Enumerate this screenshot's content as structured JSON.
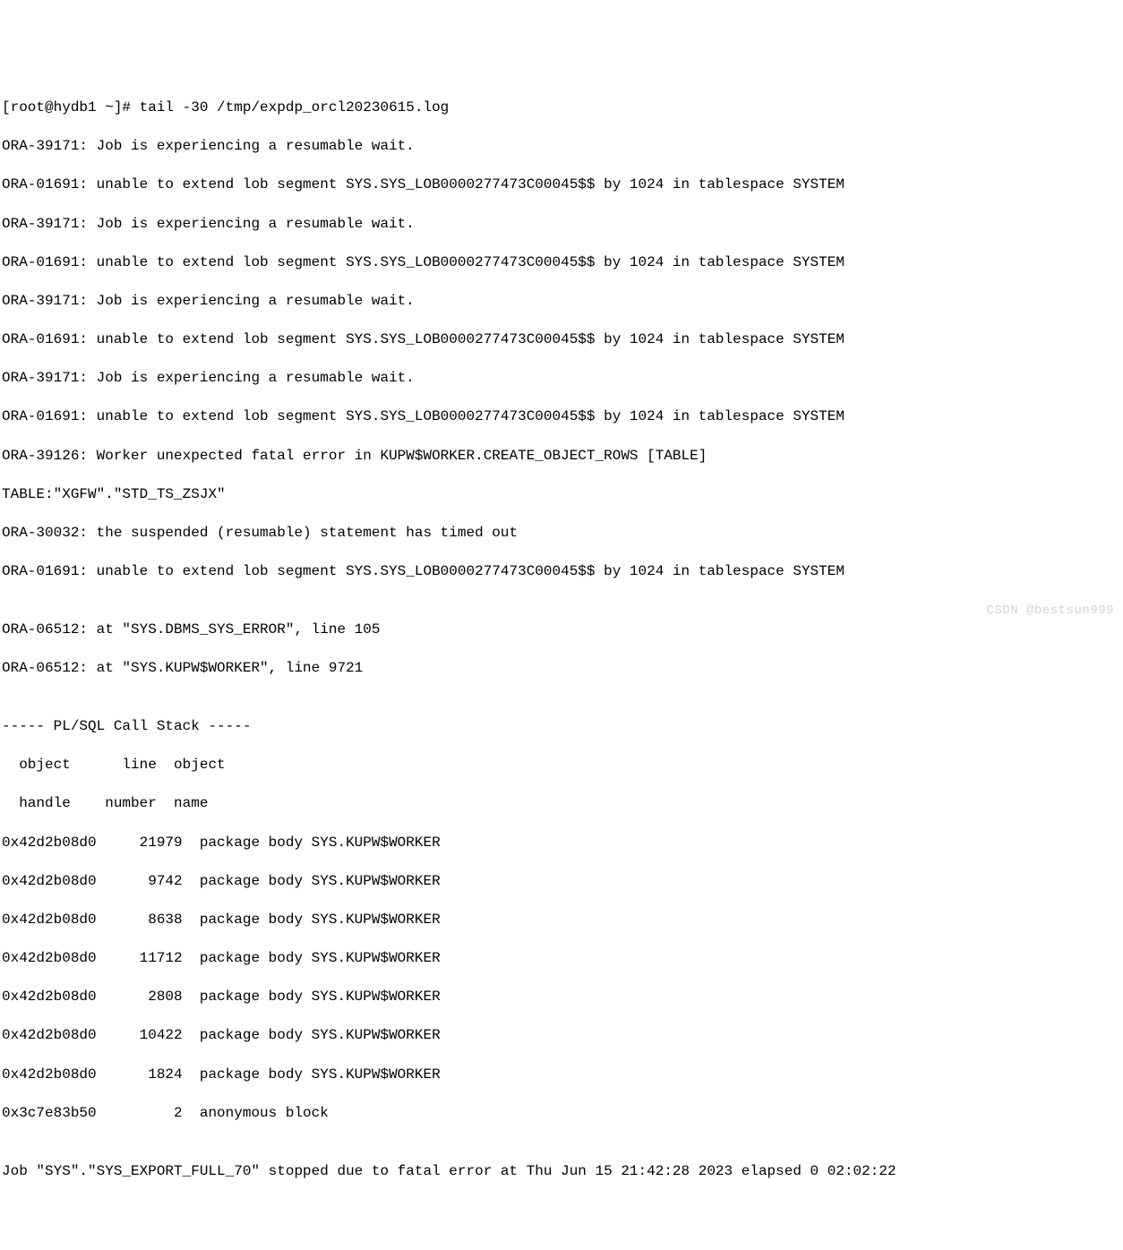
{
  "lines": {
    "l0": "[root@hydb1 ~]# tail -30 /tmp/expdp_orcl20230615.log",
    "l1": "ORA-39171: Job is experiencing a resumable wait.",
    "l2": "ORA-01691: unable to extend lob segment SYS.SYS_LOB0000277473C00045$$ by 1024 in tablespace SYSTEM",
    "l3": "ORA-39171: Job is experiencing a resumable wait.",
    "l4": "ORA-01691: unable to extend lob segment SYS.SYS_LOB0000277473C00045$$ by 1024 in tablespace SYSTEM",
    "l5": "ORA-39171: Job is experiencing a resumable wait.",
    "l6": "ORA-01691: unable to extend lob segment SYS.SYS_LOB0000277473C00045$$ by 1024 in tablespace SYSTEM",
    "l7": "ORA-39171: Job is experiencing a resumable wait.",
    "l8": "ORA-01691: unable to extend lob segment SYS.SYS_LOB0000277473C00045$$ by 1024 in tablespace SYSTEM",
    "l9": "ORA-39126: Worker unexpected fatal error in KUPW$WORKER.CREATE_OBJECT_ROWS [TABLE]",
    "l10": "TABLE:\"XGFW\".\"STD_TS_ZSJX\"",
    "l11": "ORA-30032: the suspended (resumable) statement has timed out",
    "l12": "ORA-01691: unable to extend lob segment SYS.SYS_LOB0000277473C00045$$ by 1024 in tablespace SYSTEM",
    "l13": "",
    "l14": "ORA-06512: at \"SYS.DBMS_SYS_ERROR\", line 105",
    "l15": "ORA-06512: at \"SYS.KUPW$WORKER\", line 9721",
    "l16": "",
    "l17": "----- PL/SQL Call Stack -----",
    "l18": "  object      line  object",
    "l19": "  handle    number  name",
    "l20": "0x42d2b08d0     21979  package body SYS.KUPW$WORKER",
    "l21": "0x42d2b08d0      9742  package body SYS.KUPW$WORKER",
    "l22": "0x42d2b08d0      8638  package body SYS.KUPW$WORKER",
    "l23": "0x42d2b08d0     11712  package body SYS.KUPW$WORKER",
    "l24": "0x42d2b08d0      2808  package body SYS.KUPW$WORKER",
    "l25": "0x42d2b08d0     10422  package body SYS.KUPW$WORKER",
    "l26": "0x42d2b08d0      1824  package body SYS.KUPW$WORKER",
    "l27": "0x3c7e83b50         2  anonymous block",
    "l28": "",
    "l29": "Job \"SYS\".\"SYS_EXPORT_FULL_70\" stopped due to fatal error at Thu Jun 15 21:42:28 2023 elapsed 0 02:02:22"
  },
  "watermark": "CSDN @bestsun999"
}
